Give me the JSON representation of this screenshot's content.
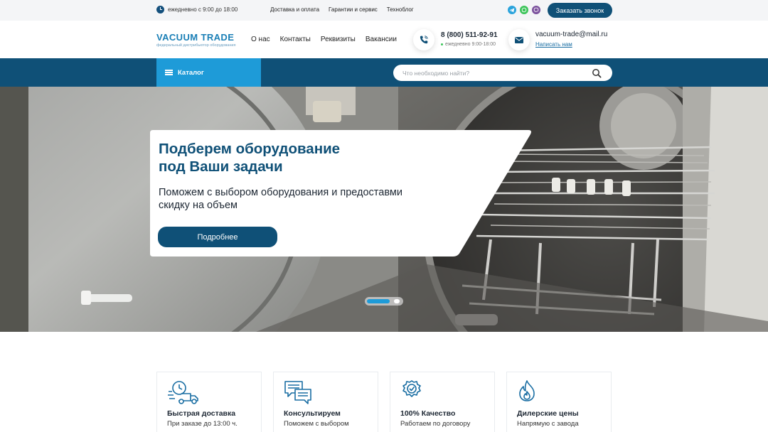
{
  "topbar": {
    "hours": "ежедневно с 9:00 до 18:00",
    "links": [
      "Доставка и оплата",
      "Гарантии и сервис",
      "Техноблог"
    ],
    "social_icons": [
      "telegram-icon",
      "whatsapp-icon",
      "viber-icon"
    ],
    "callback_label": "Заказать звонок"
  },
  "header": {
    "logo_title": "VACUUM TRADE",
    "logo_subtitle": "федеральный дистрибьютор оборудования",
    "nav": [
      "О нас",
      "Контакты",
      "Реквизиты",
      "Вакансии"
    ],
    "phone": "8 (800) 511-92-91",
    "phone_hours": "ежедневно 9:00-18:00",
    "email": "vacuum-trade@mail.ru",
    "write_us": "Написать нам"
  },
  "catalog_bar": {
    "catalog_label": "Каталог",
    "search_placeholder": "Что необходимо найти?"
  },
  "hero": {
    "title_line1": "Подберем оборудование",
    "title_line2": "под Ваши задачи",
    "text_line1": "Поможем с выбором оборудования и предоставми",
    "text_line2": "скидку на объем",
    "button_label": "Подробнее",
    "slides_total": 2,
    "slide_active": 1
  },
  "features": [
    {
      "icon": "delivery-truck-icon",
      "title": "Быстрая доставка",
      "desc": "При заказе до 13:00 ч."
    },
    {
      "icon": "chat-bubbles-icon",
      "title": "Консультируем",
      "desc": "Поможем с выбором"
    },
    {
      "icon": "quality-badge-icon",
      "title": "100% Качество",
      "desc": "Работаем по договору"
    },
    {
      "icon": "flame-icon",
      "title": "Дилерские цены",
      "desc": "Напрямую с завода"
    }
  ],
  "colors": {
    "brand_dark": "#0f5077",
    "brand_light": "#1e9bd8",
    "topbar_bg": "#f4f5f7"
  }
}
